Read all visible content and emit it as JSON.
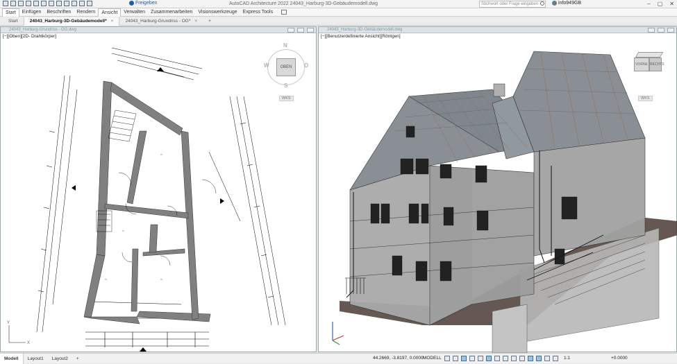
{
  "app": {
    "title": "AutoCAD Architecture 2022   24043_Harburg-3D-Gebäudemodell.dwg",
    "share_label": "Freigeben",
    "search_placeholder": "Stichwort oder Frage eingeben",
    "user": "info949GB"
  },
  "ribbon": {
    "tabs": [
      "Start",
      "Einfügen",
      "Beschriften",
      "Rendern",
      "Ansicht",
      "Verwalten",
      "Zusammenarbeiten",
      "Visionswerkzeuge",
      "Express Tools"
    ],
    "active_tab": "Ansicht"
  },
  "doc_tabs": {
    "start": "Start",
    "tabs": [
      {
        "label": "24043_Harburg-3D-Gebäudemodell*",
        "active": true
      },
      {
        "label": "24043_Harburg-Grundriss - OG*",
        "active": false
      }
    ],
    "close_symbol": "×",
    "add_symbol": "+"
  },
  "viewports": {
    "left": {
      "header": "24043_Harburg-Grundriss - OG.dwg",
      "label": "[−][Oben][2D- Drahtkörper]",
      "viewcube": {
        "face": "OBEN",
        "n": "N",
        "s": "S",
        "w": "W",
        "o": "O"
      },
      "wks": "WKS"
    },
    "right": {
      "header": "24043_Harburg-3D-Gebäudemodell.dwg",
      "label": "[−][Benutzerdefinierte Ansicht][Röntgen]",
      "viewcube": {
        "face1": "VORNE",
        "face2": "RECHTS"
      },
      "wks": "WKS"
    }
  },
  "status": {
    "tabs": [
      "Modell",
      "Layout1",
      "Layout2"
    ],
    "add": "+",
    "coords": "44.2669, -3.8197, 0.0000",
    "mode": "MODELL",
    "scale": "1:1",
    "elevation": "+0.0000"
  },
  "colors": {
    "roof": "#8a8f96",
    "wall": "#9a9a9a",
    "timber": "#a0633a",
    "ground": "#4a3a32"
  }
}
